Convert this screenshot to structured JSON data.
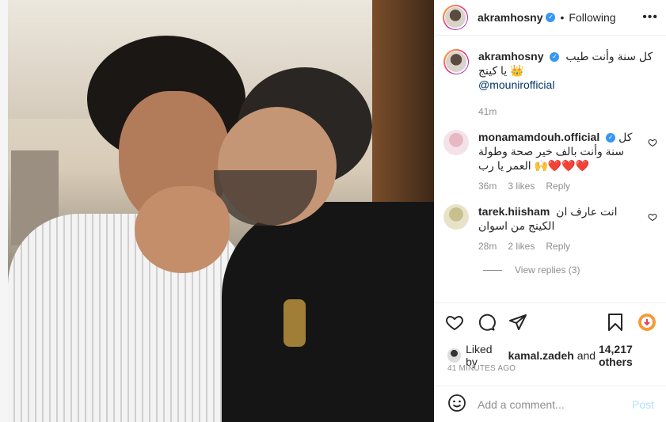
{
  "post": {
    "author": "akramhosny",
    "follow_state": "Following",
    "dot": "•",
    "more": "•••"
  },
  "caption": {
    "username": "akramhosny",
    "text": "كل سنة وأنت طيب يا كينج 👑",
    "mention": "@mounirofficial",
    "time": "41m"
  },
  "comments": [
    {
      "username": "monamamdouh.official",
      "text": "كل سنة وأنت بالف خير صحة وطولة العمر يا رب 🙌❤️❤️❤️",
      "time": "36m",
      "likes": "3 likes",
      "reply": "Reply"
    },
    {
      "username": "tarek.hiisham",
      "text": "انت عارف ان الكينج من اسوان",
      "time": "28m",
      "likes": "2 likes",
      "reply": "Reply"
    }
  ],
  "view_replies": "View replies (3)",
  "likes": {
    "prefix": "Liked by",
    "user": "kamal.zadeh",
    "and": "and",
    "count": "14,217 others"
  },
  "timestamp": "41 MINUTES AGO",
  "add_comment": {
    "placeholder": "Add a comment...",
    "post_label": "Post"
  },
  "icons": {
    "like": "heart-icon",
    "comment": "comment-icon",
    "share": "share-icon",
    "save": "bookmark-icon",
    "emoji": "emoji-icon",
    "more": "more-options-icon"
  },
  "colors": {
    "verified": "#3897f0",
    "mention": "#00376b",
    "muted": "#8e8e8e",
    "post_disabled": "#b2dffc"
  }
}
